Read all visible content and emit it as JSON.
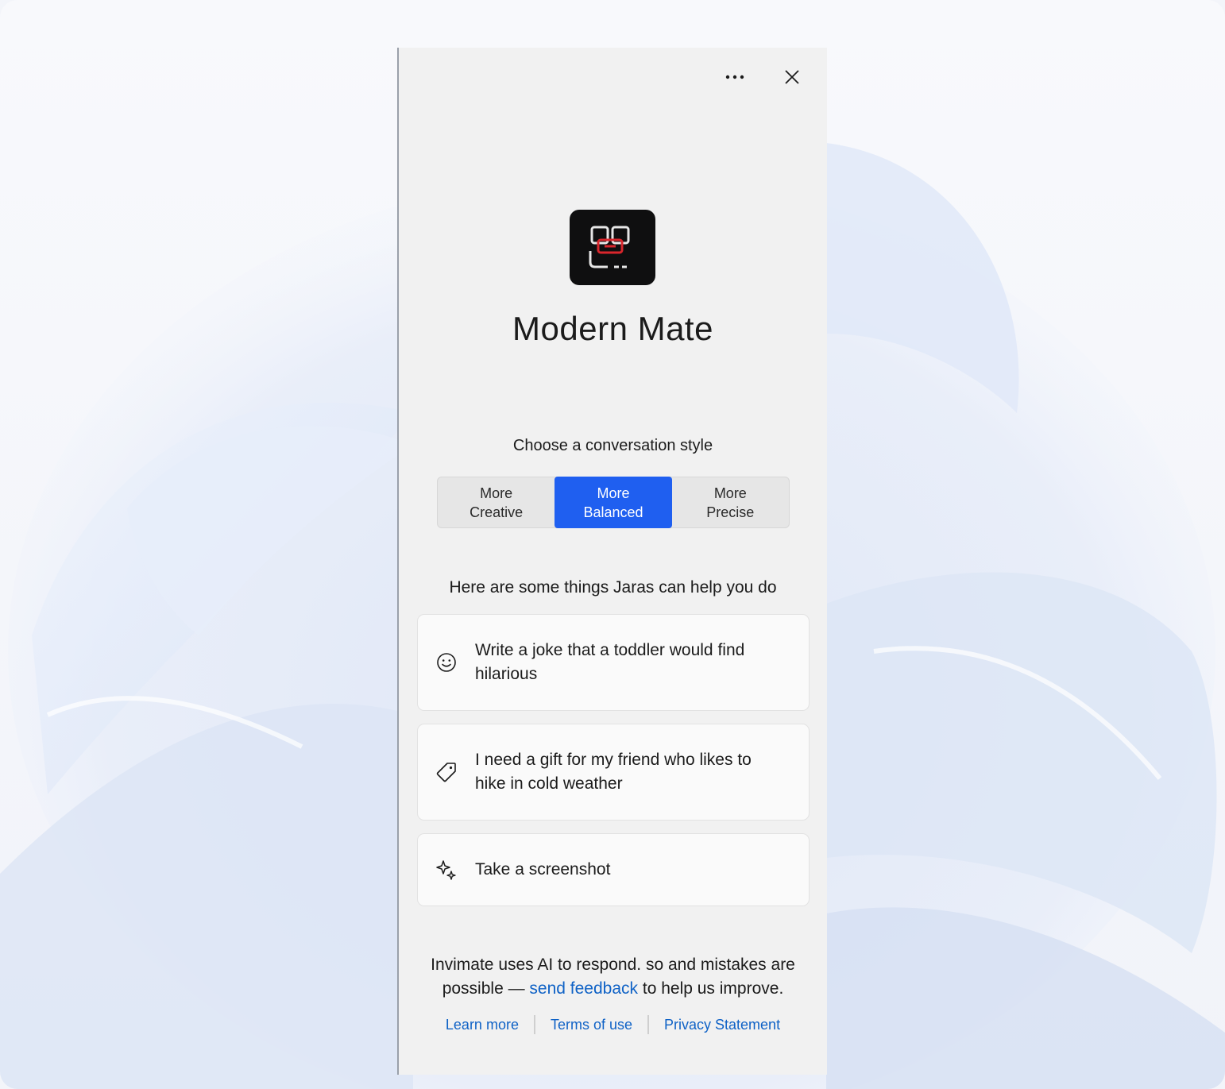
{
  "window": {
    "more_icon": "more-horizontal-icon",
    "close_icon": "close-icon"
  },
  "app": {
    "name": "Modern Mate",
    "logo_icon": "app-logo-icon"
  },
  "conversation_style": {
    "heading": "Choose a conversation style",
    "options": [
      {
        "line1": "More",
        "line2": "Creative",
        "selected": false
      },
      {
        "line1": "More",
        "line2": "Balanced",
        "selected": true
      },
      {
        "line1": "More",
        "line2": "Precise",
        "selected": false
      }
    ],
    "active_color": "#1f5ff0"
  },
  "suggestions": {
    "heading": "Here are some things Jaras can help you do",
    "items": [
      {
        "icon": "smiley-icon",
        "text": "Write a joke that a toddler would find hilarious"
      },
      {
        "icon": "tag-icon",
        "text": "I need a gift for my friend who likes to hike in cold weather"
      },
      {
        "icon": "sparkle-icon",
        "text": "Take a screenshot"
      }
    ]
  },
  "footer": {
    "disclaimer_before": "Invimate uses AI to respond. so and mistakes are possible — ",
    "feedback_link": "send feedback",
    "disclaimer_after": " to help us improve.",
    "links": [
      "Learn more",
      "Terms of use",
      "Privacy Statement"
    ],
    "link_color": "#0f62c6"
  }
}
